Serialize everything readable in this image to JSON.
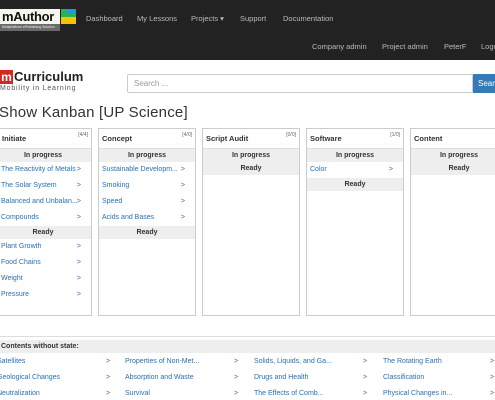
{
  "navbar": {
    "logo_text": "mAuthor",
    "logo_sub": "Multiplatform ePublishing Solution",
    "links": [
      "Dashboard",
      "My Lessons",
      "Projects ▾",
      "Support",
      "Documentation"
    ],
    "secondary": [
      "Company admin",
      "Project admin",
      "PeterF",
      "Logout"
    ]
  },
  "brand": {
    "m": "m",
    "title": "Curriculum",
    "tagline": "Mobility in Learning"
  },
  "search": {
    "placeholder": "Search ...",
    "button": "Search"
  },
  "page_title": "Show Kanban [UP Science]",
  "columns": [
    {
      "name": "Initiate",
      "count": "[4/4]",
      "states": [
        {
          "label": "In progress",
          "items": [
            "The Reactivity of Metals",
            "The Solar System",
            "Balanced and Unbalan...",
            "Compounds"
          ]
        },
        {
          "label": "Ready",
          "items": [
            "Plant Growth",
            "Food Chains",
            "Weight",
            "Pressure"
          ]
        }
      ]
    },
    {
      "name": "Concept",
      "count": "[4/0]",
      "states": [
        {
          "label": "In progress",
          "items": [
            "Sustainable Developm...",
            "Smoking",
            "Speed",
            "Acids and Bases"
          ]
        },
        {
          "label": "Ready",
          "items": []
        }
      ]
    },
    {
      "name": "Script Audit",
      "count": "[0/0]",
      "states": [
        {
          "label": "In progress",
          "items": []
        },
        {
          "label": "Ready",
          "items": []
        }
      ]
    },
    {
      "name": "Software",
      "count": "[1/0]",
      "states": [
        {
          "label": "In progress",
          "items": [
            "Color"
          ]
        },
        {
          "label": "Ready",
          "items": []
        }
      ]
    },
    {
      "name": "Content",
      "count": "",
      "states": [
        {
          "label": "In progress",
          "items": []
        },
        {
          "label": "Ready",
          "items": []
        }
      ]
    }
  ],
  "contents_without_state": {
    "label": "Contents without state:",
    "rows": [
      [
        "Satellites",
        "Properties of Non-Met...",
        "Solids, Liquids, and Ga...",
        "The Rotating Earth"
      ],
      [
        "Geological Changes",
        "Absorption and Waste",
        "Drugs and Health",
        "Classification"
      ],
      [
        "Neutralization",
        "Survival",
        "The Effects of Comb...",
        "Physical Changes in..."
      ]
    ]
  },
  "arrow": ">"
}
